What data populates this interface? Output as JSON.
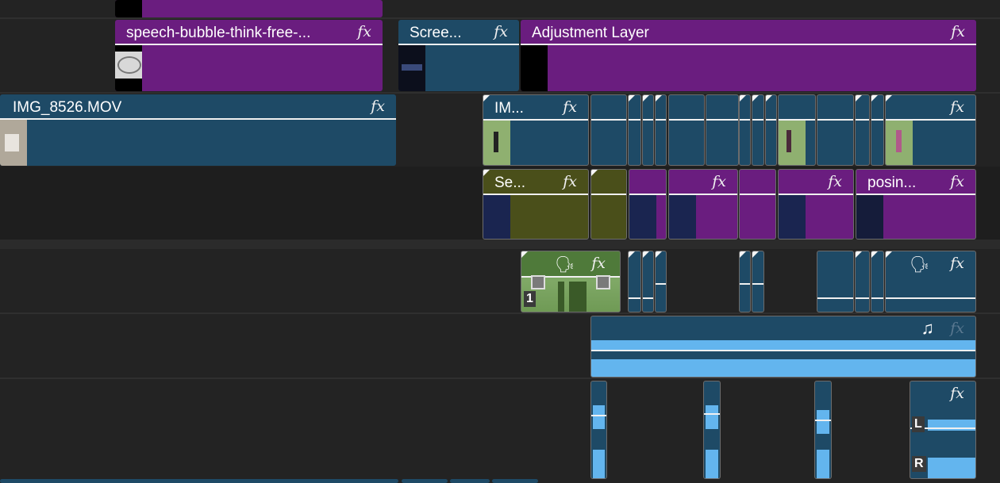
{
  "timeline": {
    "video_track_4": {
      "clip_speech_bubble": {
        "label": "speech-bubble-think-free-...",
        "fx": "fx"
      },
      "clip_screen": {
        "label": "Scree...",
        "fx": "fx"
      },
      "clip_adjustment": {
        "label": "Adjustment Layer",
        "fx": "fx"
      }
    },
    "video_track_3": {
      "clip_img_8526": {
        "label": "IMG_8526.MOV",
        "fx": "fx"
      },
      "clip_im": {
        "label": "IM...",
        "fx": "fx"
      },
      "clip_last": {
        "fx": "fx"
      }
    },
    "video_track_2": {
      "clip_se": {
        "label": "Se...",
        "fx": "fx"
      },
      "clip_purple_a": {
        "fx": "fx"
      },
      "clip_purple_b": {
        "fx": "fx"
      },
      "clip_posin": {
        "label": "posin...",
        "fx": "fx"
      }
    },
    "audio_track_1": {
      "clip_voice_green": {
        "fx": "fx",
        "speaker_icon": "speaking-head-icon",
        "badge": "1"
      },
      "clip_voice_blue": {
        "fx": "fx",
        "speaker_icon": "speaking-head-icon"
      }
    },
    "audio_track_2": {
      "clip_music": {
        "fx": "fx",
        "music_icon": "music-note-icon"
      }
    },
    "audio_track_3": {
      "clip_stereo": {
        "fx": "fx",
        "left_label": "L",
        "right_label": "R"
      }
    }
  },
  "colors": {
    "video_clip_blue": "#1e4a66",
    "adjustment_purple": "#6a1d7f",
    "nested_olive": "#4a4f1a",
    "voice_green": "#7fa866",
    "audio_blue": "#63b5ee",
    "background": "#232323"
  }
}
